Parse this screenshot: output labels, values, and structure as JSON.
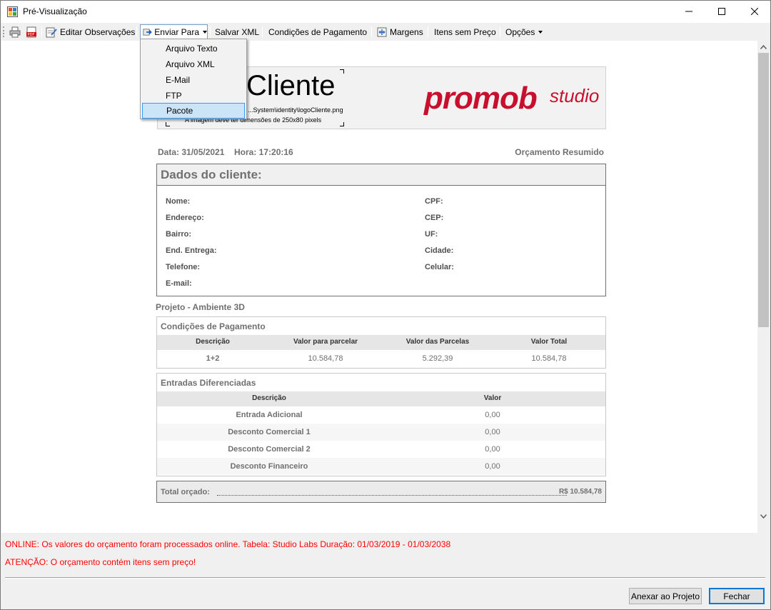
{
  "window": {
    "title": "Pré-Visualização"
  },
  "toolbar": {
    "editar_observacoes": "Editar Observações",
    "enviar_para": "Enviar Para",
    "salvar_xml": "Salvar XML",
    "condicoes_pagamento": "Condições de Pagamento",
    "margens": "Margens",
    "itens_sem_preco": "Itens sem Preço",
    "opcoes": "Opções"
  },
  "dropdown": {
    "items": [
      "Arquivo Texto",
      "Arquivo XML",
      "E-Mail",
      "FTP",
      "Pacote"
    ],
    "highlighted": "Pacote"
  },
  "report": {
    "logo": {
      "placeholder_text": "Cliente",
      "path": "...System\\identity\\logoCliente.png",
      "hint": "A imagem deve ter dimensões de 250x80 pixels",
      "brand_main": "promob",
      "brand_sub": "studio"
    },
    "data_label": "Data: 31/05/2021",
    "hora_label": "Hora: 17:20:16",
    "tipo": "Orçamento Resumido",
    "cliente": {
      "heading": "Dados do cliente:",
      "left_fields": [
        "Nome:",
        "Endereço:",
        "Bairro:",
        "End. Entrega:",
        "Telefone:",
        "E-mail:"
      ],
      "right_fields": [
        "CPF:",
        "CEP:",
        "UF:",
        "Cidade:",
        "Celular:"
      ]
    },
    "projeto": "Projeto - Ambiente 3D",
    "condicoes": {
      "title": "Condições de Pagamento",
      "headers": [
        "Descrição",
        "Valor para parcelar",
        "Valor das Parcelas",
        "Valor Total"
      ],
      "rows": [
        [
          "1+2",
          "10.584,78",
          "5.292,39",
          "10.584,78"
        ]
      ]
    },
    "entradas": {
      "title": "Entradas Diferenciadas",
      "headers": [
        "Descrição",
        "Valor"
      ],
      "rows": [
        [
          "Entrada Adicional",
          "0,00"
        ],
        [
          "Desconto Comercial 1",
          "0,00"
        ],
        [
          "Desconto Comercial 2",
          "0,00"
        ],
        [
          "Desconto Financeiro",
          "0,00"
        ]
      ]
    },
    "total": {
      "label": "Total orçado:",
      "value": "R$ 10.584,78"
    }
  },
  "messages": {
    "online": "ONLINE: Os valores do orçamento foram processados online. Tabela:  Studio Labs Duração: 01/03/2019 - 01/03/2038",
    "atencao": "ATENÇÃO: O orçamento contém itens sem preço!"
  },
  "buttons": {
    "anexar": "Anexar ao Projeto",
    "fechar": "Fechar"
  },
  "colors": {
    "brand_red": "#c8102e",
    "warning_red": "#ff0000",
    "accent_blue": "#0078d7"
  }
}
